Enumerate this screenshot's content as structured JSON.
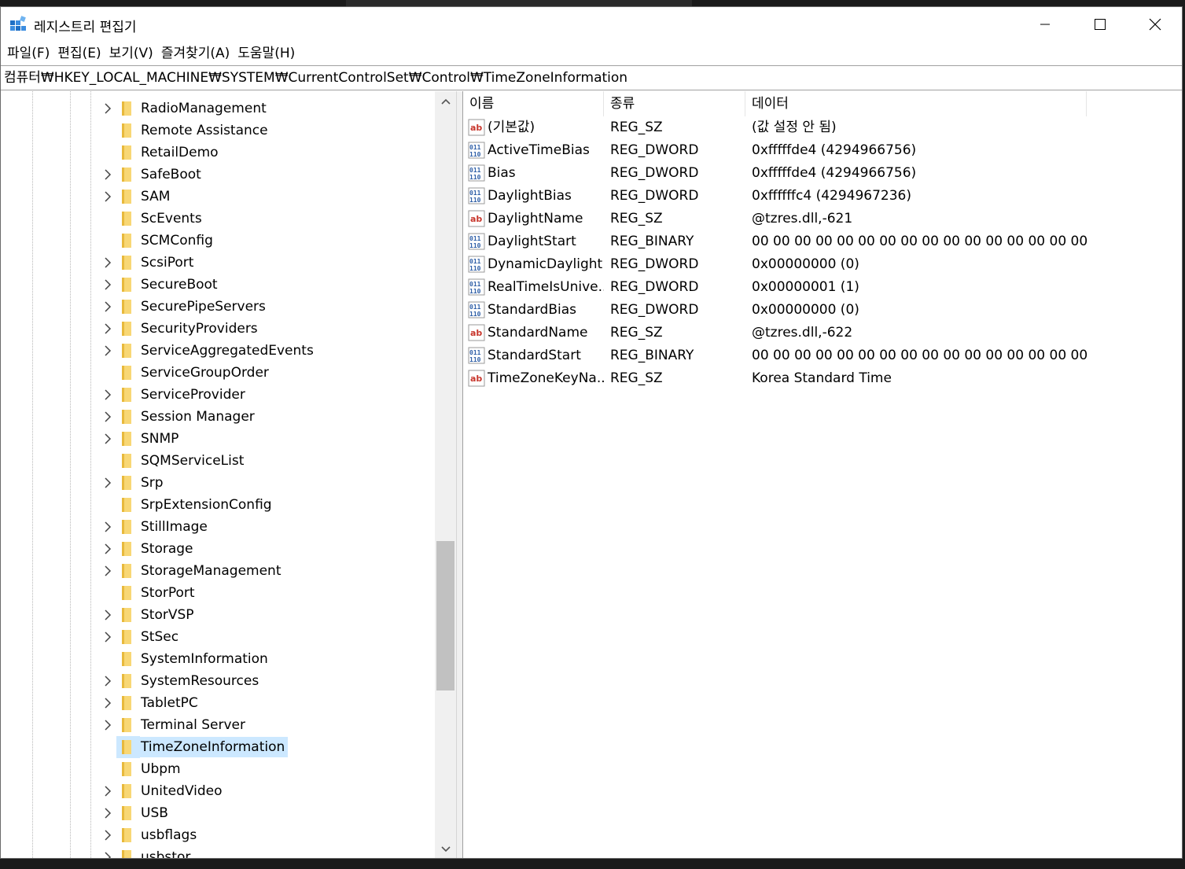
{
  "window": {
    "title": "레지스트리 편집기"
  },
  "menu": [
    "파일(F)",
    "편집(E)",
    "보기(V)",
    "즐겨찾기(A)",
    "도움말(H)"
  ],
  "address": "컴퓨터₩HKEY_LOCAL_MACHINE₩SYSTEM₩CurrentControlSet₩Control₩TimeZoneInformation",
  "tree": [
    {
      "label": "RadioManagement",
      "expandable": true
    },
    {
      "label": "Remote Assistance",
      "expandable": false
    },
    {
      "label": "RetailDemo",
      "expandable": false
    },
    {
      "label": "SafeBoot",
      "expandable": true
    },
    {
      "label": "SAM",
      "expandable": true
    },
    {
      "label": "ScEvents",
      "expandable": false
    },
    {
      "label": "SCMConfig",
      "expandable": false
    },
    {
      "label": "ScsiPort",
      "expandable": true
    },
    {
      "label": "SecureBoot",
      "expandable": true
    },
    {
      "label": "SecurePipeServers",
      "expandable": true
    },
    {
      "label": "SecurityProviders",
      "expandable": true
    },
    {
      "label": "ServiceAggregatedEvents",
      "expandable": true
    },
    {
      "label": "ServiceGroupOrder",
      "expandable": false
    },
    {
      "label": "ServiceProvider",
      "expandable": true
    },
    {
      "label": "Session Manager",
      "expandable": true
    },
    {
      "label": "SNMP",
      "expandable": true
    },
    {
      "label": "SQMServiceList",
      "expandable": false
    },
    {
      "label": "Srp",
      "expandable": true
    },
    {
      "label": "SrpExtensionConfig",
      "expandable": false
    },
    {
      "label": "StillImage",
      "expandable": true
    },
    {
      "label": "Storage",
      "expandable": true
    },
    {
      "label": "StorageManagement",
      "expandable": true
    },
    {
      "label": "StorPort",
      "expandable": false
    },
    {
      "label": "StorVSP",
      "expandable": true
    },
    {
      "label": "StSec",
      "expandable": true
    },
    {
      "label": "SystemInformation",
      "expandable": false
    },
    {
      "label": "SystemResources",
      "expandable": true
    },
    {
      "label": "TabletPC",
      "expandable": true
    },
    {
      "label": "Terminal Server",
      "expandable": true
    },
    {
      "label": "TimeZoneInformation",
      "expandable": false,
      "selected": true
    },
    {
      "label": "Ubpm",
      "expandable": false
    },
    {
      "label": "UnitedVideo",
      "expandable": true
    },
    {
      "label": "USB",
      "expandable": true
    },
    {
      "label": "usbflags",
      "expandable": true
    },
    {
      "label": "usbstor",
      "expandable": true
    }
  ],
  "columns": {
    "name": "이름",
    "type": "종류",
    "data": "데이터"
  },
  "values": [
    {
      "icon": "string-value-icon",
      "name": "(기본값)",
      "type": "REG_SZ",
      "data": "(값 설정 안 됨)"
    },
    {
      "icon": "binary-value-icon",
      "name": "ActiveTimeBias",
      "type": "REG_DWORD",
      "data": "0xfffffde4 (4294966756)"
    },
    {
      "icon": "binary-value-icon",
      "name": "Bias",
      "type": "REG_DWORD",
      "data": "0xfffffde4 (4294966756)"
    },
    {
      "icon": "binary-value-icon",
      "name": "DaylightBias",
      "type": "REG_DWORD",
      "data": "0xffffffc4 (4294967236)"
    },
    {
      "icon": "string-value-icon",
      "name": "DaylightName",
      "type": "REG_SZ",
      "data": "@tzres.dll,-621"
    },
    {
      "icon": "binary-value-icon",
      "name": "DaylightStart",
      "type": "REG_BINARY",
      "data": "00 00 00 00 00 00 00 00 00 00 00 00 00 00 00 00"
    },
    {
      "icon": "binary-value-icon",
      "name": "DynamicDaylight...",
      "type": "REG_DWORD",
      "data": "0x00000000 (0)"
    },
    {
      "icon": "binary-value-icon",
      "name": "RealTimeIsUnive...",
      "type": "REG_DWORD",
      "data": "0x00000001 (1)"
    },
    {
      "icon": "binary-value-icon",
      "name": "StandardBias",
      "type": "REG_DWORD",
      "data": "0x00000000 (0)"
    },
    {
      "icon": "string-value-icon",
      "name": "StandardName",
      "type": "REG_SZ",
      "data": "@tzres.dll,-622"
    },
    {
      "icon": "binary-value-icon",
      "name": "StandardStart",
      "type": "REG_BINARY",
      "data": "00 00 00 00 00 00 00 00 00 00 00 00 00 00 00 00"
    },
    {
      "icon": "string-value-icon",
      "name": "TimeZoneKeyNa...",
      "type": "REG_SZ",
      "data": "Korea Standard Time"
    }
  ],
  "colors": {
    "selection": "#cce8ff",
    "folder": "#f8d775",
    "string_icon": "#c8372d",
    "binary_icon": "#2f5fa7"
  }
}
